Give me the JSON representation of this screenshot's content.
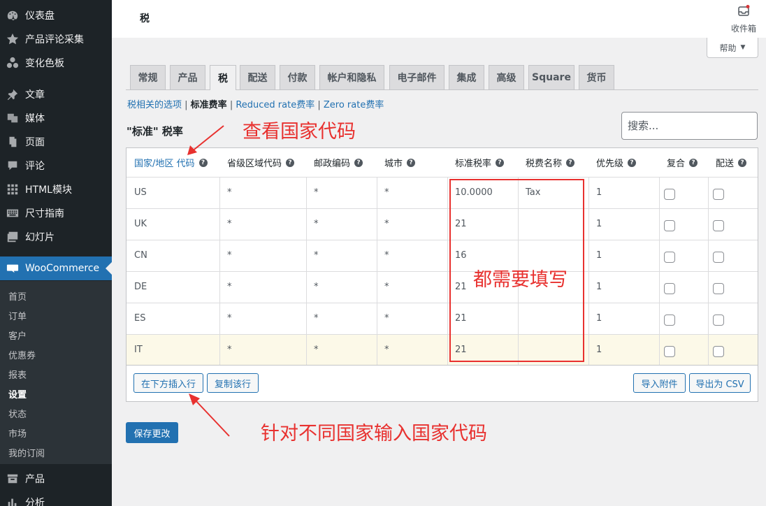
{
  "sidebar": {
    "items": [
      {
        "label": "仪表盘",
        "icon": "dashboard-icon"
      },
      {
        "label": "产品评论采集",
        "icon": "star-icon"
      },
      {
        "label": "变化色板",
        "icon": "swatches-icon"
      },
      {
        "label": "文章",
        "icon": "pin-icon"
      },
      {
        "label": "媒体",
        "icon": "media-icon"
      },
      {
        "label": "页面",
        "icon": "page-icon"
      },
      {
        "label": "评论",
        "icon": "comment-icon"
      },
      {
        "label": "HTML模块",
        "icon": "grid-icon"
      },
      {
        "label": "尺寸指南",
        "icon": "keyboard-icon"
      },
      {
        "label": "幻灯片",
        "icon": "slides-icon"
      },
      {
        "label": "WooCommerce",
        "icon": "woo-icon"
      },
      {
        "label": "产品",
        "icon": "archive-icon"
      },
      {
        "label": "分析",
        "icon": "chart-icon"
      }
    ],
    "submenu": [
      "首页",
      "订单",
      "客户",
      "优惠券",
      "报表",
      "设置",
      "状态",
      "市场",
      "我的订阅"
    ],
    "active_submenu": "设置"
  },
  "topbar": {
    "title": "税",
    "inbox_label": "收件箱",
    "help_label": "帮助"
  },
  "tabs": [
    "常规",
    "产品",
    "税",
    "配送",
    "付款",
    "帐户和隐私",
    "电子邮件",
    "集成",
    "高级",
    "Square",
    "货币"
  ],
  "active_tab": "税",
  "subnav": {
    "link1": "税相关的选项",
    "sep1": " | ",
    "current": "标准费率",
    "sep2": " | ",
    "link2": "Reduced rate费率",
    "sep3": " | ",
    "link3": "Zero rate费率"
  },
  "section_title": "\"标准\" 税率",
  "search_placeholder": "搜索...",
  "table": {
    "headers": [
      "国家/地区 代码",
      "省级区域代码",
      "邮政编码",
      "城市",
      "标准税率",
      "税费名称",
      "优先级",
      "复合",
      "配送"
    ],
    "rows": [
      [
        "US",
        "*",
        "*",
        "*",
        "10.0000",
        "Tax",
        "1"
      ],
      [
        "UK",
        "*",
        "*",
        "*",
        "21",
        "",
        "1"
      ],
      [
        "CN",
        "*",
        "*",
        "*",
        "16",
        "",
        "1"
      ],
      [
        "DE",
        "*",
        "*",
        "*",
        "21",
        "",
        "1"
      ],
      [
        "ES",
        "*",
        "*",
        "*",
        "21",
        "",
        "1"
      ],
      [
        "IT",
        "*",
        "*",
        "*",
        "21",
        "",
        "1"
      ]
    ],
    "buttons": {
      "insert_row": "在下方插入行",
      "duplicate_row": "复制该行",
      "import": "导入附件",
      "export": "导出为 CSV"
    }
  },
  "save_label": "保存更改",
  "annotations": {
    "country_code": "查看国家代码",
    "must_fill": "都需要填写",
    "enter_codes": "针对不同国家输入国家代码"
  },
  "colors": {
    "sidebar_bg": "#1d2327",
    "accent": "#2271b1",
    "highlight_row": "#fcf9e8",
    "annotation_red": "#e8312f"
  }
}
